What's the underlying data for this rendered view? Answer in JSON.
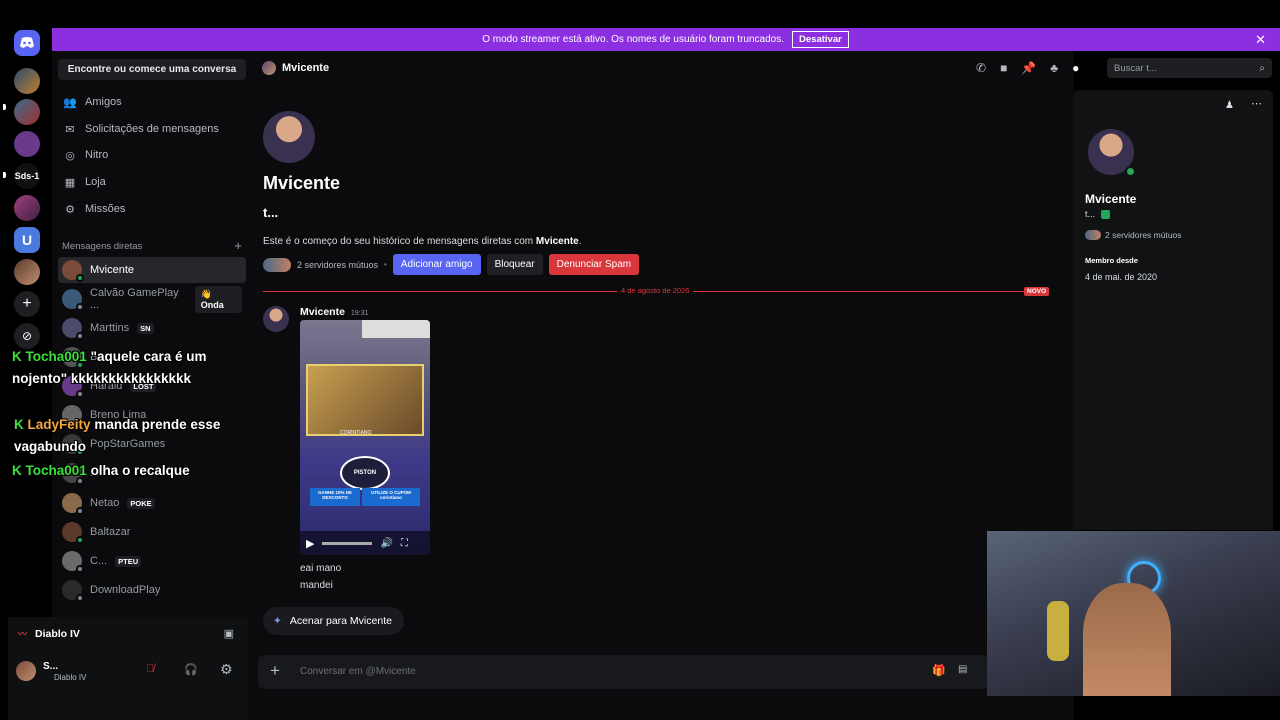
{
  "banner": {
    "text": "O modo streamer está ativo. Os nomes de usuário foram truncados.",
    "button": "Desativar"
  },
  "rail": {
    "sds_label": "Sds-1",
    "u_label": "U"
  },
  "sidebar": {
    "search": "Encontre ou comece uma conversa",
    "nav": [
      {
        "label": "Amigos",
        "icon": "people-icon"
      },
      {
        "label": "Solicitações de mensagens",
        "icon": "mail-icon"
      },
      {
        "label": "Nitro",
        "icon": "nitro-icon"
      },
      {
        "label": "Loja",
        "icon": "shop-icon"
      },
      {
        "label": "Missões",
        "icon": "quest-icon"
      }
    ],
    "dm_header": "Mensagens diretas",
    "dms": [
      {
        "name": "Mvicente",
        "tag": "",
        "color": "#7a4a3a"
      },
      {
        "name": "Calvão GamePlay ...",
        "tag": "",
        "color": "#3a5a7a"
      },
      {
        "name": "Marttins",
        "tag": "SN",
        "color": "#4a4a6a"
      },
      {
        "name": "Ba...",
        "tag": "",
        "color": "#555"
      },
      {
        "name": "Harald",
        "tag": "LOST",
        "color": "#6a3a8a"
      },
      {
        "name": "Breno Lima",
        "tag": "",
        "color": "#666"
      },
      {
        "name": "PopStarGames",
        "tag": "",
        "color": "#3a3a3a"
      },
      {
        "name": "...",
        "tag": "",
        "color": "#444"
      },
      {
        "name": "Netao",
        "tag": "POKE",
        "color": "#8a6a4a"
      },
      {
        "name": "Baltazar",
        "tag": "",
        "color": "#5a3a2a"
      },
      {
        "name": "C...",
        "tag": "PTEU",
        "color": "#6a6a6a"
      },
      {
        "name": "DownloadPlay",
        "tag": "",
        "color": "#2a2a2a"
      }
    ],
    "wave_chip": "Onda"
  },
  "stream_chat": [
    {
      "user": "Tocha001",
      "msg": "\"aquele cara é um nojento\" kkkkkkkkkkkkkkkk",
      "color": "#3be13b"
    },
    {
      "user": "LadyFeity",
      "msg": "manda prende esse vagabundo",
      "color": "#f5a742"
    },
    {
      "user": "Tocha001",
      "msg": "olha o recalque",
      "color": "#3be13b"
    }
  ],
  "user_panel": {
    "activity": "Diablo IV",
    "user": "S...",
    "status": "Diablo IV"
  },
  "main": {
    "header_name": "Mvicente",
    "profile_name": "Mvicente",
    "profile_handle": "t...",
    "intro_prefix": "Este é o começo do seu histórico de mensagens diretas com ",
    "intro_name": "Mvicente",
    "intro_suffix": ".",
    "mutual": "2 servidores mútuos",
    "btn_add": "Adicionar amigo",
    "btn_block": "Bloquear",
    "btn_spam": "Denunciar Spam",
    "date_divider": "4 de agosto de 2026",
    "new_badge": "NOVO",
    "msg_author": "Mvicente",
    "msg_time": "19:31",
    "video_caption_top": "CORINTIANO",
    "video_brand": "PISTON",
    "video_promo1": "GANHE 10% DE DESCONTO",
    "video_promo2": "UTILIZE O CUPOM corintiano",
    "msg_lines": [
      "eai mano",
      "mandei"
    ],
    "wave_button": "Acenar para Mvicente",
    "input_placeholder": "Conversar em @Mvicente",
    "search_placeholder": "Buscar t..."
  },
  "profile_panel": {
    "name": "Mvicente",
    "handle": "t...",
    "mutual": "2 servidores mútuos",
    "member_label": "Membro desde",
    "member_date": "4 de mai. de 2020"
  },
  "colors": {
    "accent": "#5865f2",
    "danger": "#da373c",
    "streamer": "#8b2fe0",
    "online": "#23a55a"
  }
}
